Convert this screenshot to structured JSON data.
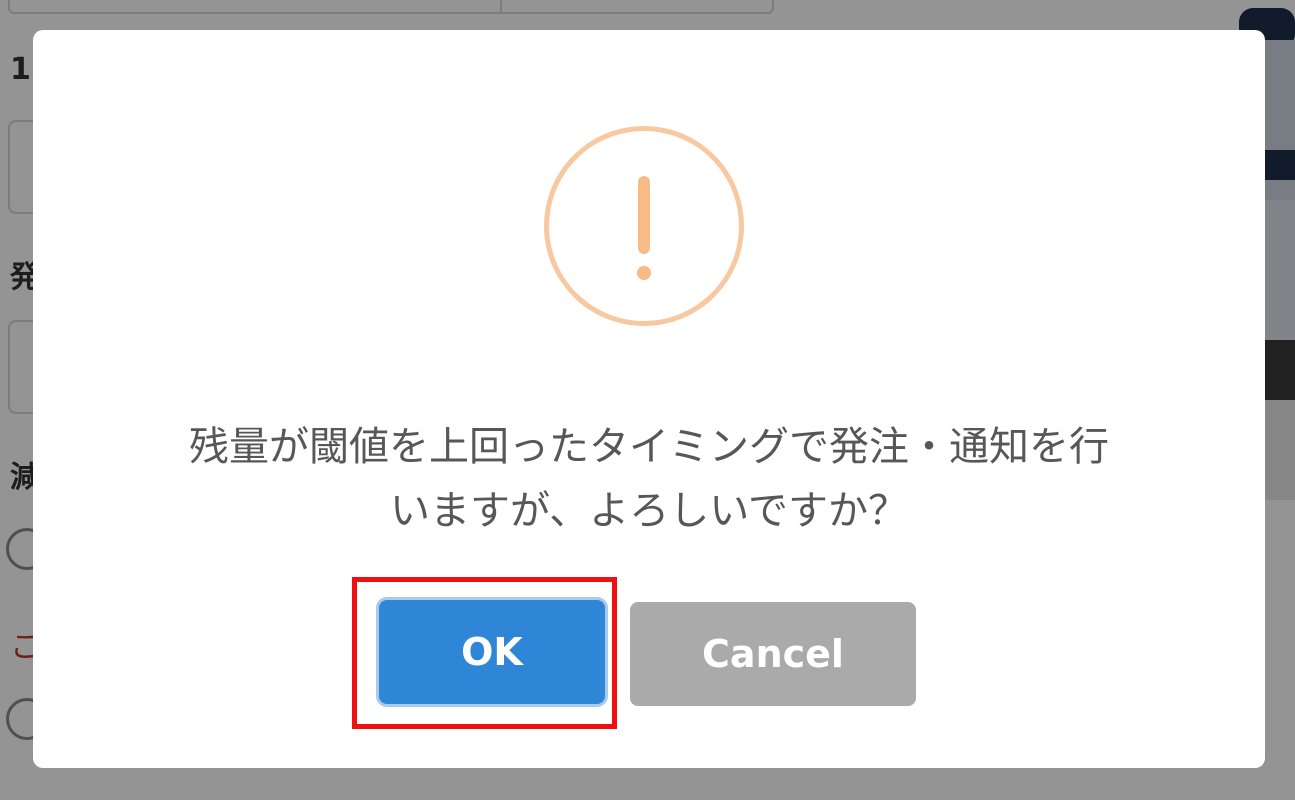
{
  "background_form": {
    "labels": [
      "1",
      "発",
      "減",
      "こ"
    ]
  },
  "dialog": {
    "icon": "warning-exclamation-icon",
    "icon_color": "#f8bb86",
    "message_line1": "残量が閾値を上回ったタイミングで発注・通知を行",
    "message_line2": "いますが、よろしいですか？",
    "ok_label": "OK",
    "cancel_label": "Cancel",
    "ok_color": "#2f86d6",
    "cancel_color": "#aaaaaa"
  },
  "highlight_color": "#ee1111"
}
